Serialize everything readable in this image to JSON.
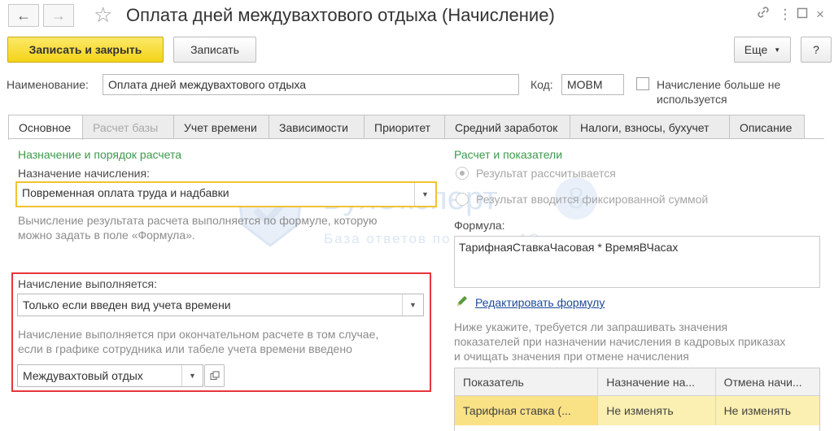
{
  "window": {
    "title": "Оплата дней междувахтового отдыха (Начисление)",
    "icons": {
      "back": "arrow-left-icon",
      "forward": "arrow-right-icon",
      "favorite": "star-icon",
      "link": "link-icon",
      "menu": "more-vertical-icon",
      "maximize": "maximize-icon",
      "close": "close-icon"
    }
  },
  "toolbar": {
    "save_close": "Записать и закрыть",
    "save": "Записать",
    "more": "Еще",
    "help": "?"
  },
  "header": {
    "name_label": "Наименование:",
    "name_value": "Оплата дней междувахтового отдыха",
    "code_label": "Код:",
    "code_value": "МОВМ",
    "inactive_label_1": "Начисление больше не",
    "inactive_label_2": "используется"
  },
  "tabs": [
    {
      "label": "Основное",
      "active": true
    },
    {
      "label": "Расчет базы",
      "disabled": true
    },
    {
      "label": "Учет времени"
    },
    {
      "label": "Зависимости"
    },
    {
      "label": "Приоритет"
    },
    {
      "label": "Средний заработок"
    },
    {
      "label": "Налоги, взносы, бухучет"
    },
    {
      "label": "Описание"
    }
  ],
  "left": {
    "section_title": "Назначение и порядок расчета",
    "purpose_label": "Назначение начисления:",
    "purpose_value": "Повременная оплата труда и надбавки",
    "purpose_hint_1": "Вычисление результата расчета выполняется по формуле, которую",
    "purpose_hint_2": "можно задать в поле «Формула».",
    "exec_label": "Начисление выполняется:",
    "exec_value": "Только если введен вид учета времени",
    "exec_hint_1": "Начисление выполняется при окончательном расчете в том случае,",
    "exec_hint_2": "если в графике сотрудника или табеле учета времени введено",
    "time_type_value": "Междувахтовый отдых"
  },
  "right": {
    "section_title": "Расчет и показатели",
    "radio_1": "Результат рассчитывается",
    "radio_2": "Результат вводится фиксированной суммой",
    "formula_label": "Формула:",
    "formula_value": "ТарифнаяСтавкаЧасовая * ВремяВЧасах",
    "edit_link": "Редактировать формулу",
    "note_1": "Ниже укажите, требуется ли запрашивать значения",
    "note_2": "показателей при назначении начисления в кадровых приказах",
    "note_3": "и очищать значения при отмене начисления",
    "table": {
      "columns": [
        "Показатель",
        "Назначение на...",
        "Отмена начи..."
      ],
      "rows": [
        [
          "Тарифная ставка (...",
          "Не изменять",
          "Не изменять"
        ]
      ]
    }
  },
  "watermark": {
    "brand": "БухЭксперт",
    "digit": "8",
    "tagline": "База ответов по учету в 1С"
  },
  "colors": {
    "accent_yellow": "#f3d318",
    "focus_border": "#f1c232",
    "highlight_red": "#e8363b",
    "section_green": "#3b9a4b",
    "link_blue": "#1f4a97",
    "selected_row": "#fbefb1"
  }
}
